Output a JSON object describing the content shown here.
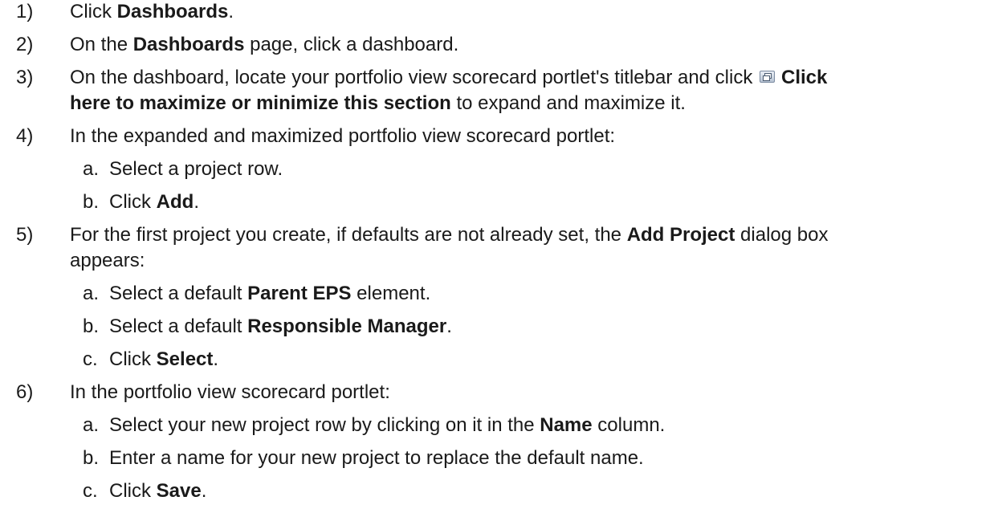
{
  "steps": {
    "s1": {
      "num": "1)",
      "pre": "Click ",
      "b1": "Dashboards",
      "post": "."
    },
    "s2": {
      "num": "2)",
      "pre": "On the ",
      "b1": "Dashboards",
      "post": " page, click a dashboard."
    },
    "s3": {
      "num": "3)",
      "pre": "On the dashboard, locate your portfolio view scorecard portlet's titlebar and click ",
      "icon": "maximize-minimize-icon",
      "b1a": "Click",
      "b1b": "here to maximize or minimize this section",
      "post": " to expand and maximize it."
    },
    "s4": {
      "num": "4)",
      "text": "In the expanded and maximized portfolio view scorecard portlet:",
      "a": {
        "letter": "a.",
        "text": "Select a project row."
      },
      "b": {
        "letter": "b.",
        "pre": "Click ",
        "b1": "Add",
        "post": "."
      }
    },
    "s5": {
      "num": "5)",
      "pre": "For the first project you create, if defaults are not already set, the ",
      "b1": "Add Project",
      "post": " dialog box",
      "cont": "appears:",
      "a": {
        "letter": "a.",
        "pre": "Select a default ",
        "b1": "Parent EPS",
        "post": " element."
      },
      "b": {
        "letter": "b.",
        "pre": "Select a default ",
        "b1": "Responsible Manager",
        "post": "."
      },
      "c": {
        "letter": "c.",
        "pre": "Click ",
        "b1": "Select",
        "post": "."
      }
    },
    "s6": {
      "num": "6)",
      "text": "In the portfolio view scorecard portlet:",
      "a": {
        "letter": "a.",
        "pre": "Select your new project row by clicking on it in the ",
        "b1": "Name",
        "post": " column."
      },
      "b": {
        "letter": "b.",
        "text": "Enter a name for your new project to replace the default name."
      },
      "c": {
        "letter": "c.",
        "pre": "Click ",
        "b1": "Save",
        "post": "."
      }
    }
  }
}
